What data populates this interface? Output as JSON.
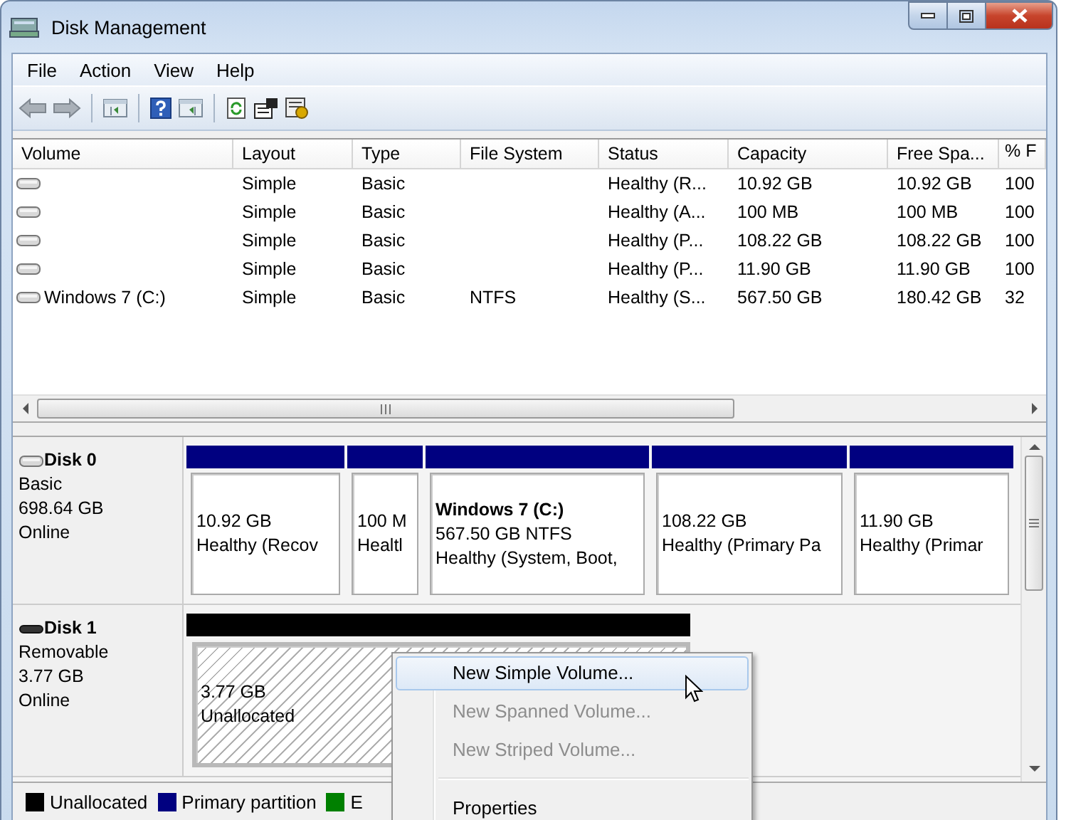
{
  "window": {
    "title": "Disk Management"
  },
  "menu": [
    "File",
    "Action",
    "View",
    "Help"
  ],
  "table": {
    "columns": [
      "Volume",
      "Layout",
      "Type",
      "File System",
      "Status",
      "Capacity",
      "Free Spa...",
      "% F"
    ],
    "rows": [
      {
        "layout": "Simple",
        "type": "Basic",
        "status": "Healthy (R...",
        "capacity": "10.92 GB",
        "free_space": "10.92 GB",
        "percent_free": "100"
      },
      {
        "layout": "Simple",
        "type": "Basic",
        "status": "Healthy (A...",
        "capacity": "100 MB",
        "free_space": "100 MB",
        "percent_free": "100"
      },
      {
        "layout": "Simple",
        "type": "Basic",
        "status": "Healthy (P...",
        "capacity": "108.22 GB",
        "free_space": "108.22 GB",
        "percent_free": "100"
      },
      {
        "layout": "Simple",
        "type": "Basic",
        "status": "Healthy (P...",
        "capacity": "11.90 GB",
        "free_space": "11.90 GB",
        "percent_free": "100"
      },
      {
        "volume": "Windows 7 (C:)",
        "layout": "Simple",
        "type": "Basic",
        "file_system": "NTFS",
        "status": "Healthy (S...",
        "capacity": "567.50 GB",
        "free_space": "180.42 GB",
        "percent_free": "32"
      }
    ]
  },
  "disks": [
    {
      "name": "Disk 0",
      "kind": "basic",
      "type": "Basic",
      "size": "698.64 GB",
      "status": "Online",
      "partitions": [
        {
          "kind": "primary",
          "size": "10.92 GB",
          "status": "Healthy (Recov"
        },
        {
          "kind": "primary",
          "size": "100 M",
          "status": "Healtl"
        },
        {
          "kind": "primary",
          "label": "Windows 7  (C:)",
          "size": "567.50 GB NTFS",
          "status": "Healthy (System, Boot,"
        },
        {
          "kind": "primary",
          "size": "108.22 GB",
          "status": "Healthy (Primary Pa"
        },
        {
          "kind": "primary",
          "size": "11.90 GB",
          "status": "Healthy (Primar"
        }
      ]
    },
    {
      "name": "Disk 1",
      "kind": "removable",
      "type": "Removable",
      "size": "3.77 GB",
      "status": "Online",
      "partitions": [
        {
          "kind": "unallocated",
          "size": "3.77 GB",
          "status": "Unallocated"
        }
      ]
    }
  ],
  "legend": [
    {
      "label": "Unallocated",
      "color": "#000000"
    },
    {
      "label": "Primary partition",
      "color": "#000080"
    },
    {
      "label": "E",
      "color": "#008000"
    }
  ],
  "context_menu": [
    {
      "kind": "item",
      "label": "New Simple Volume...",
      "selected": true,
      "disabled": false
    },
    {
      "kind": "item",
      "label": "New Spanned Volume...",
      "selected": false,
      "disabled": true
    },
    {
      "kind": "item",
      "label": "New Striped Volume...",
      "selected": false,
      "disabled": true
    },
    {
      "kind": "separator"
    },
    {
      "kind": "item",
      "label": "Properties",
      "selected": false,
      "disabled": false
    }
  ]
}
